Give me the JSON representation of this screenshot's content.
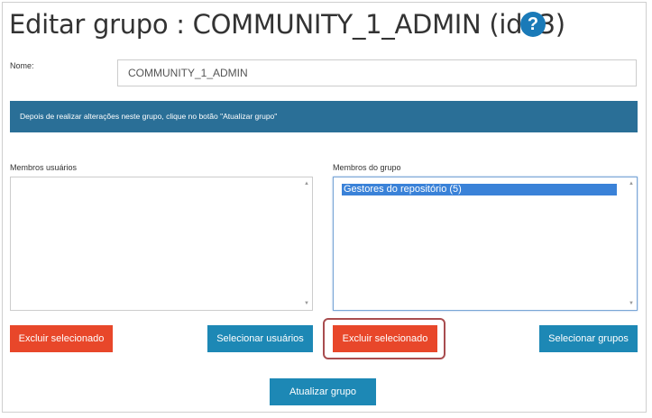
{
  "header": {
    "title": "Editar grupo : COMMUNITY_1_ADMIN (id: 3)",
    "help_glyph": "?",
    "help_icon": "question-circle-icon"
  },
  "form": {
    "name_label": "Nome:",
    "name_value": "COMMUNITY_1_ADMIN"
  },
  "notice": {
    "text": "Depois de realizar alterações neste grupo, clique no botão \"Atualizar grupo\""
  },
  "user_members": {
    "label": "Membros usuários",
    "items": []
  },
  "group_members": {
    "label": "Membros do grupo",
    "items": [
      "Gestores do repositório (5)"
    ],
    "selected_index": 0
  },
  "buttons": {
    "delete_users": "Excluir selecionado",
    "select_users": "Selecionar usuários",
    "delete_groups": "Excluir selecionado",
    "select_groups": "Selecionar grupos",
    "update": "Atualizar grupo"
  },
  "scroll": {
    "up": "▲",
    "down": "▼"
  },
  "colors": {
    "primary_blue": "#1d88b5",
    "notice_blue": "#2a6f97",
    "danger_red": "#e8472a",
    "highlight_border": "#a84d4f",
    "selection_blue": "#3a82d8"
  }
}
